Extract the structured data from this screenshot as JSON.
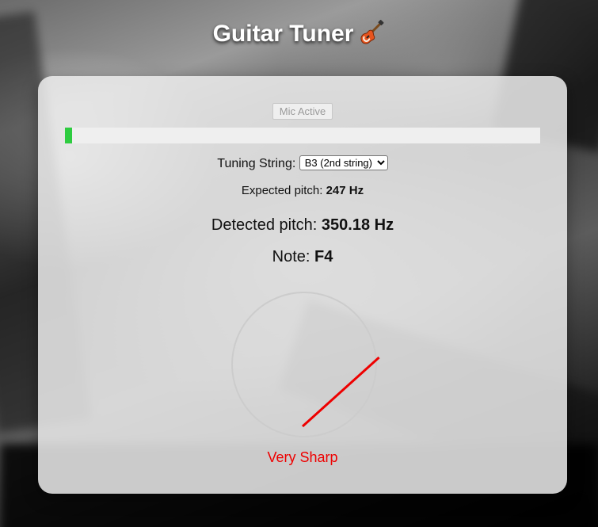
{
  "header": {
    "title": "Guitar Tuner",
    "icon": "electric-guitar-icon"
  },
  "controls": {
    "mic_button_label": "Mic Active",
    "level_fraction": 0.015,
    "level_color": "#2ecc40"
  },
  "tuning": {
    "label": "Tuning String:",
    "selected": "B3 (2nd string)"
  },
  "expected": {
    "label": "Expected pitch:",
    "value": "247 Hz"
  },
  "detected": {
    "label": "Detected pitch:",
    "value": "350.18 Hz"
  },
  "note": {
    "label": "Note:",
    "value": "F4"
  },
  "gauge": {
    "needle_angle_deg": 48,
    "needle_color": "#ee0000",
    "ring_color": "#cccccc"
  },
  "status": {
    "text": "Very Sharp",
    "color": "#ee0000"
  }
}
